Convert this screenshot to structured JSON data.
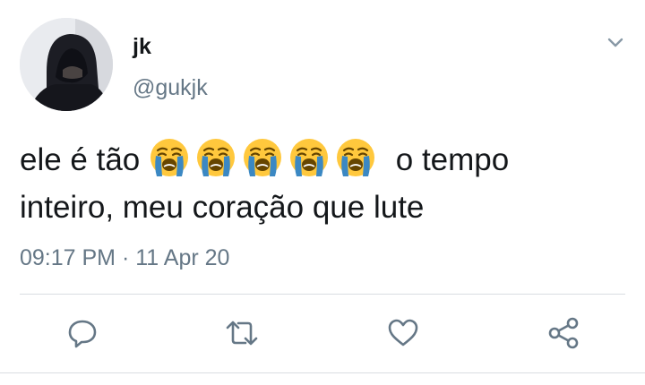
{
  "author": {
    "display_name": "jk",
    "handle": "@gukjk",
    "avatar_icon": "hooded-person-avatar"
  },
  "tweet": {
    "text_before": "ele é tão",
    "emoji_icon": "loudly-crying-face-emoji",
    "emoji_count": 5,
    "text_after": "o tempo inteiro, meu coração que lute",
    "time": "09:17 PM",
    "separator": "·",
    "date": "11 Apr 20"
  },
  "actions": [
    {
      "name": "reply",
      "icon": "speech-bubble-icon"
    },
    {
      "name": "retweet",
      "icon": "retweet-arrows-icon"
    },
    {
      "name": "like",
      "icon": "heart-icon"
    },
    {
      "name": "share",
      "icon": "share-icon"
    }
  ],
  "colors": {
    "text": "#14171a",
    "secondary": "#657786",
    "divider": "#d9dde2",
    "emoji_face": "#ffc83d",
    "emoji_tears": "#3b88c3"
  }
}
